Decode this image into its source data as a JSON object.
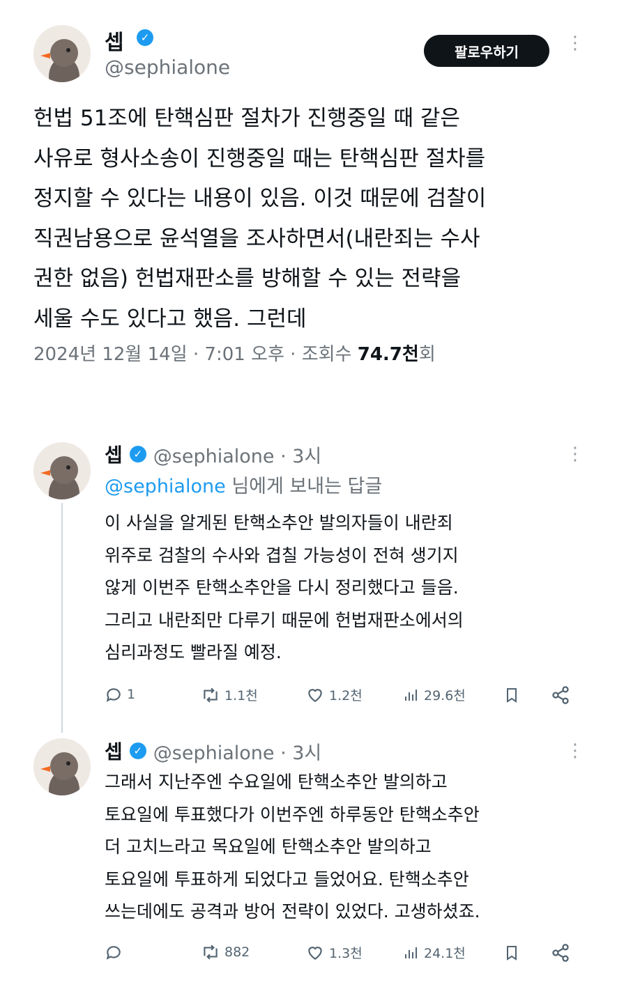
{
  "main_tweet": {
    "name": "셉",
    "handle": "@sephialone",
    "follow_label": "팔로우하기",
    "text": "헌법 51조에 탄핵심판 절차가 진행중일 때 같은\n사유로 형사소송이 진행중일 때는 탄핵심판 절차를\n정지할 수 있다는 내용이 있음. 이것 때문에 검찰이\n직권남용으로 윤석열을 조사하면서(내란죄는 수사\n권한 없음) 헌법재판소를 방해할 수 있는 전략을\n세울 수도 있다고 했음. 그런데",
    "meta_prefix": "2024년 12월 14일 · 7:01 오후 · 조회수 ",
    "views_value": "74.7천",
    "views_suffix": "회"
  },
  "replies": [
    {
      "name": "셉",
      "handle_time": "@sephialone · 3시",
      "reply_to_handle": "@sephialone",
      "reply_to_suffix": " 님에게 보내는 답글",
      "text": "이 사실을 알게된 탄핵소추안 발의자들이 내란죄\n위주로 검찰의 수사와 겹칠 가능성이 전혀 생기지\n않게 이번주 탄핵소추안을 다시 정리했다고 들음.\n그리고 내란죄만 다루기 때문에 헌법재판소에서의\n심리과정도 빨라질 예정.",
      "replies_count": "1",
      "retweets": "1.1천",
      "likes": "1.2천",
      "views": "29.6천"
    },
    {
      "name": "셉",
      "handle_time": "@sephialone · 3시",
      "text": "그래서 지난주엔 수요일에 탄핵소추안 발의하고\n토요일에 투표했다가 이번주엔 하루동안 탄핵소추안\n더 고치느라고 목요일에 탄핵소추안 발의하고\n토요일에 투표하게 되었다고 들었어요. 탄핵소추안\n쓰는데에도 공격과 방어 전략이 있었다. 고생하셨죠.",
      "replies_count": "",
      "retweets": "882",
      "likes": "1.3천",
      "views": "24.1천"
    }
  ],
  "icons": {
    "verified": "verified-badge-icon",
    "more": "more-options-icon",
    "reply": "reply-icon",
    "retweet": "retweet-icon",
    "like": "like-icon",
    "views": "views-icon",
    "bookmark": "bookmark-icon",
    "share": "share-icon"
  },
  "colors": {
    "accent": "#1d9bf0",
    "text": "#0f1419",
    "muted": "#536471"
  }
}
